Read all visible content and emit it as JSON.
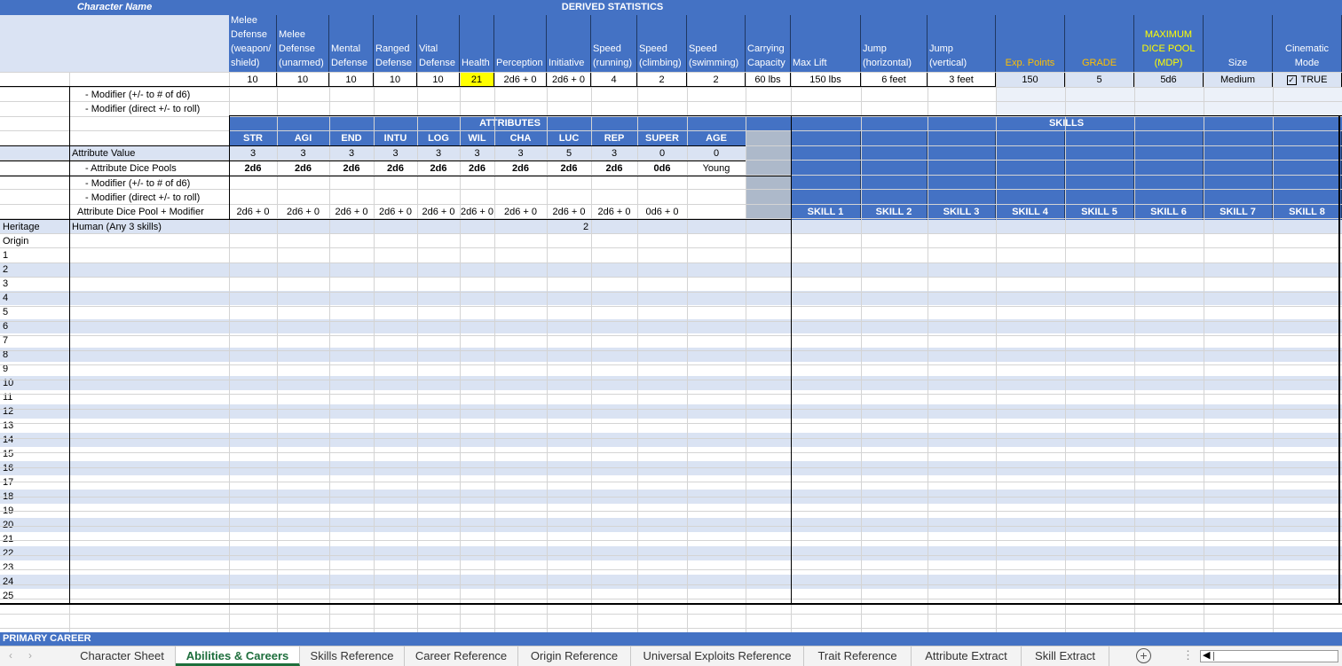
{
  "title_row": {
    "character_name_label": "Character Name",
    "derived_title": "DERIVED STATISTICS"
  },
  "derived": {
    "headers": [
      "Melee Defense (weapon/ shield)",
      "Melee Defense (unarmed)",
      "Mental Defense",
      "Ranged Defense",
      "Vital Defense",
      "Health",
      "Perception",
      "Initiative",
      "Speed (running)",
      "Speed (climbing)",
      "Speed (swimming)",
      "Carrying Capacity",
      "Max Lift",
      "Jump (horizontal)",
      "Jump (vertical)",
      "Exp. Points",
      "GRADE",
      "MAXIMUM DICE POOL (MDP)",
      "Size",
      "Cinematic Mode"
    ],
    "values": [
      "10",
      "10",
      "10",
      "10",
      "10",
      "21",
      "2d6 + 0",
      "2d6 + 0",
      "4",
      "2",
      "2",
      "60 lbs",
      "150 lbs",
      "6 feet",
      "3 feet",
      "150",
      "5",
      "5d6",
      "Medium",
      "TRUE"
    ],
    "highlight_color": "#ffff00",
    "gold_color": "#ffc000",
    "yellow_color": "#ffff00"
  },
  "modifier_labels": [
    "- Modifier (+/- to # of d6)",
    "- Modifier (direct +/- to roll)"
  ],
  "attributes": {
    "title": "ATTRIBUTES",
    "names": [
      "STR",
      "AGI",
      "END",
      "INTU",
      "LOG",
      "WIL",
      "CHA",
      "LUC",
      "REP",
      "SUPER",
      "AGE"
    ],
    "value_label": "Attribute Value",
    "values": [
      "3",
      "3",
      "3",
      "3",
      "3",
      "3",
      "3",
      "5",
      "3",
      "0",
      "0"
    ],
    "pool_label": "- Attribute Dice Pools",
    "pools": [
      "2d6",
      "2d6",
      "2d6",
      "2d6",
      "2d6",
      "2d6",
      "2d6",
      "2d6",
      "2d6",
      "0d6",
      "Young"
    ],
    "mod_labels": [
      "- Modifier (+/- to # of d6)",
      "- Modifier (direct +/- to roll)",
      "Attribute Dice Pool + Modifier"
    ],
    "totals": [
      "2d6 + 0",
      "2d6 + 0",
      "2d6 + 0",
      "2d6 + 0",
      "2d6 + 0",
      "2d6 + 0",
      "2d6 + 0",
      "2d6 + 0",
      "2d6 + 0",
      "0d6 + 0"
    ]
  },
  "skills": {
    "title": "SKILLS",
    "names": [
      "SKILL 1",
      "SKILL 2",
      "SKILL 3",
      "SKILL 4",
      "SKILL 5",
      "SKILL 6",
      "SKILL 7",
      "SKILL 8"
    ]
  },
  "rows": {
    "heritage_label": "Heritage",
    "heritage_value": "Human (Any 3 skills)",
    "heritage_number": "2",
    "origin_label": "Origin",
    "numbers": [
      "1",
      "2",
      "3",
      "4",
      "5",
      "6",
      "7",
      "8",
      "9",
      "10",
      "11",
      "12",
      "13",
      "14",
      "15",
      "16",
      "17",
      "18",
      "19",
      "20",
      "21",
      "22",
      "23",
      "24",
      "25"
    ]
  },
  "primary_career_label": "PRIMARY CAREER",
  "tabs": [
    "Character Sheet",
    "Abilities & Careers",
    "Skills Reference",
    "Career Reference",
    "Origin Reference",
    "Universal Exploits Reference",
    "Trait Reference",
    "Attribute Extract",
    "Skill Extract"
  ],
  "active_tab": "Abilities & Careers",
  "cinematic_checkbox_checked": true,
  "icons": {
    "add_sheet": "plus-circle-icon",
    "more": "vertical-dots-icon",
    "prev": "arrow-left-icon",
    "next": "arrow-right-icon"
  }
}
